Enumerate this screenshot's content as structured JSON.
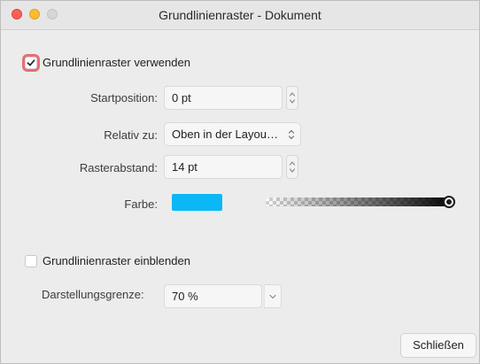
{
  "window": {
    "title": "Grundlinienraster - Dokument"
  },
  "use_grid": {
    "label": "Grundlinienraster verwenden",
    "checked": true
  },
  "fields": {
    "start_position": {
      "label": "Startposition:",
      "value": "0 pt"
    },
    "relative_to": {
      "label": "Relativ zu:",
      "value": "Oben in der Layou…"
    },
    "spacing": {
      "label": "Rasterabstand:",
      "value": "14 pt"
    },
    "color": {
      "label": "Farbe:",
      "swatch_color": "#0ab8f5",
      "opacity": 1.0
    }
  },
  "show_grid": {
    "label": "Grundlinienraster einblenden",
    "checked": false
  },
  "display_limit": {
    "label": "Darstellungsgrenze:",
    "value": "70 %"
  },
  "footer": {
    "close_label": "Schließen"
  },
  "colors": {
    "focus_ring": "#e56f75",
    "close_dot": "#fe5f57",
    "minimize_dot": "#febc2e",
    "zoom_dot": "#d6d6d6"
  },
  "icons": {
    "checkmark": "checkmark-icon",
    "stepper": "up-down-arrows-icon",
    "dropdown": "chevron-down-icon"
  }
}
